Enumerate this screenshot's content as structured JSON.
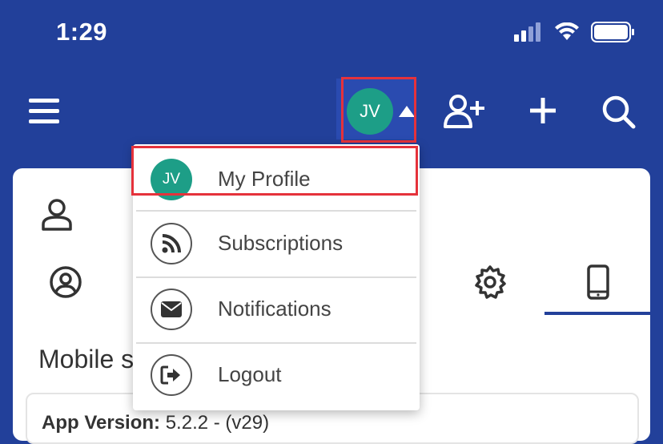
{
  "status_bar": {
    "time": "1:29"
  },
  "header": {
    "avatar_initials": "JV",
    "icons": [
      "menu-icon",
      "add-user-icon",
      "plus-icon",
      "search-icon"
    ]
  },
  "dropdown": {
    "items": [
      {
        "label": "My Profile",
        "icon": "avatar",
        "initials": "JV"
      },
      {
        "label": "Subscriptions",
        "icon": "rss-icon"
      },
      {
        "label": "Notifications",
        "icon": "envelope-icon"
      },
      {
        "label": "Logout",
        "icon": "logout-icon"
      }
    ]
  },
  "page": {
    "section_title": "Mobile s",
    "app_version_label": "App Version:",
    "app_version_value": "5.2.2 - (v29)"
  },
  "colors": {
    "header_bg": "#22409a",
    "avatar_bg": "#1d9e87",
    "highlight": "#e5323b"
  }
}
